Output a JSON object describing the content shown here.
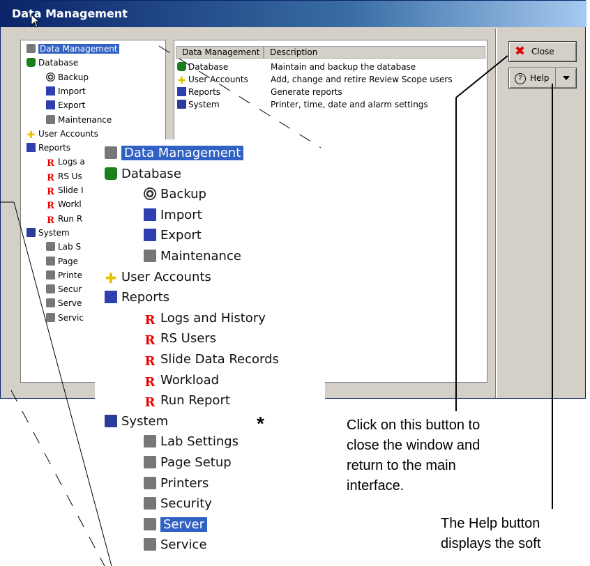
{
  "window": {
    "title": "Data Management"
  },
  "tree": {
    "items": [
      {
        "label": "Data Management",
        "icon": "tree-root-icon",
        "level": 0,
        "selected": true
      },
      {
        "label": "Database",
        "icon": "database-icon",
        "level": 0
      },
      {
        "label": "Backup",
        "icon": "backup-icon",
        "level": 1
      },
      {
        "label": "Import",
        "icon": "import-icon",
        "level": 1
      },
      {
        "label": "Export",
        "icon": "export-icon",
        "level": 1
      },
      {
        "label": "Maintenance",
        "icon": "maintenance-icon",
        "level": 1
      },
      {
        "label": "User Accounts",
        "icon": "user-accounts-icon",
        "level": 0
      },
      {
        "label": "Reports",
        "icon": "reports-icon",
        "level": 0
      },
      {
        "label": "Logs a",
        "icon": "report-r-icon",
        "level": 1
      },
      {
        "label": "RS Us",
        "icon": "report-r-icon",
        "level": 1
      },
      {
        "label": "Slide I",
        "icon": "report-r-icon",
        "level": 1
      },
      {
        "label": "Workl",
        "icon": "report-r-icon",
        "level": 1
      },
      {
        "label": "Run R",
        "icon": "report-r-icon",
        "level": 1
      },
      {
        "label": "System",
        "icon": "system-icon",
        "level": 0
      },
      {
        "label": "Lab S",
        "icon": "lab-settings-icon",
        "level": 1
      },
      {
        "label": "Page",
        "icon": "page-setup-icon",
        "level": 1
      },
      {
        "label": "Printe",
        "icon": "printers-icon",
        "level": 1
      },
      {
        "label": "Secur",
        "icon": "security-icon",
        "level": 1
      },
      {
        "label": "Serve",
        "icon": "server-icon",
        "level": 1
      },
      {
        "label": "Servic",
        "icon": "service-icon",
        "level": 1
      }
    ]
  },
  "list": {
    "columns": [
      "Data Management",
      "Description"
    ],
    "rows": [
      {
        "name": "Database",
        "description": "Maintain and backup the database"
      },
      {
        "name": "User Accounts",
        "description": "Add, change and retire Review Scope users"
      },
      {
        "name": "Reports",
        "description": "Generate reports"
      },
      {
        "name": "System",
        "description": "Printer, time, date and alarm settings"
      }
    ]
  },
  "buttons": {
    "close_label": "Close",
    "help_label": "Help"
  },
  "zoom_tree": {
    "items": [
      {
        "label": "Data Management",
        "level": 0,
        "selected": true
      },
      {
        "label": "Database",
        "level": 0
      },
      {
        "label": "Backup",
        "level": 1
      },
      {
        "label": "Import",
        "level": 1
      },
      {
        "label": "Export",
        "level": 1
      },
      {
        "label": "Maintenance",
        "level": 1
      },
      {
        "label": "User Accounts",
        "level": 0
      },
      {
        "label": "Reports",
        "level": 0
      },
      {
        "label": "Logs and History",
        "level": 1
      },
      {
        "label": "RS Users",
        "level": 1
      },
      {
        "label": "Slide Data Records",
        "level": 1
      },
      {
        "label": "Workload",
        "level": 1
      },
      {
        "label": "Run Report",
        "level": 1
      },
      {
        "label": "System",
        "level": 0
      },
      {
        "label": "Lab Settings",
        "level": 1
      },
      {
        "label": "Page Setup",
        "level": 1
      },
      {
        "label": "Printers",
        "level": 1
      },
      {
        "label": "Security",
        "level": 1
      },
      {
        "label": "Server",
        "level": 1,
        "selected": true
      },
      {
        "label": "Service",
        "level": 1
      }
    ]
  },
  "annotations": {
    "star": "*",
    "close_callout": [
      "Click on this button to",
      "close the window and",
      "return to the main",
      "interface."
    ],
    "help_callout": [
      "The Help button",
      "displays the soft"
    ]
  }
}
